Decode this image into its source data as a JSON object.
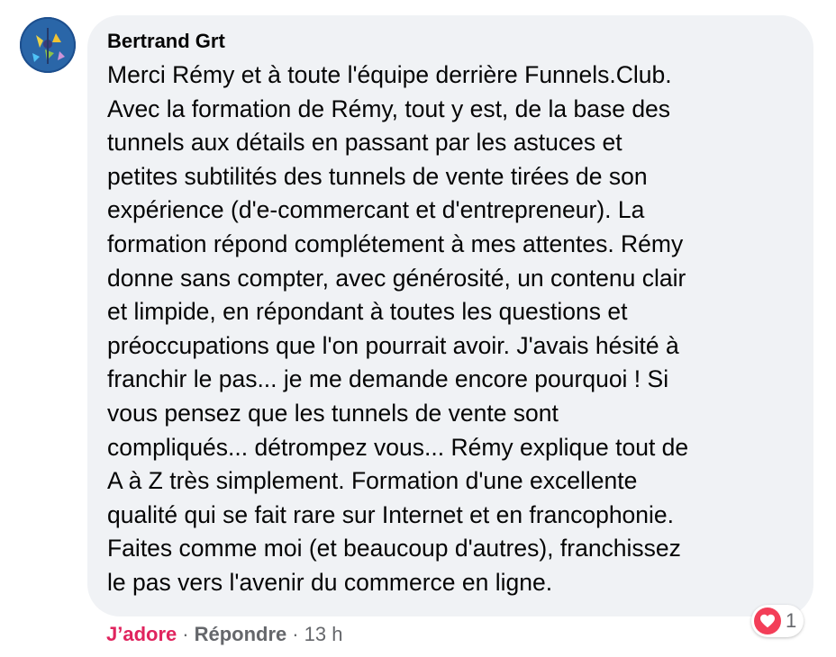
{
  "comment": {
    "author": "Bertrand Grt",
    "lines": [
      "Merci Rémy et à toute l'équipe derrière Funnels.Club.",
      "Avec la formation de Rémy, tout y est, de la base des",
      "tunnels aux détails en passant par les astuces et",
      "petites subtilités des tunnels de vente tirées de son",
      "expérience (d'e-commercant et d'entrepreneur). La",
      "formation répond complétement à mes attentes. Rémy",
      "donne sans compter, avec générosité, un contenu clair",
      "et limpide, en répondant à toutes les questions et",
      "préoccupations que l'on pourrait avoir. J'avais hésité à",
      "franchir le pas... je me demande encore pourquoi ! Si",
      "vous pensez que les tunnels de vente sont",
      "compliqués... détrompez vous... Rémy explique tout de",
      "A à Z très simplement. Formation d'une excellente",
      "qualité qui se fait rare sur Internet et en francophonie.",
      "Faites comme moi (et beaucoup d'autres), franchissez",
      "le pas vers l'avenir du commerce en ligne."
    ]
  },
  "actions": {
    "like_label": "J’adore",
    "separator": "·",
    "reply_label": "Répondre",
    "time": "13 h"
  },
  "reactions": {
    "icon": "heart-icon",
    "count": "1"
  },
  "colors": {
    "bubble": "#f0f2f5",
    "like_active": "#e0245e",
    "heart": "#f33e58",
    "muted": "#65676b"
  }
}
